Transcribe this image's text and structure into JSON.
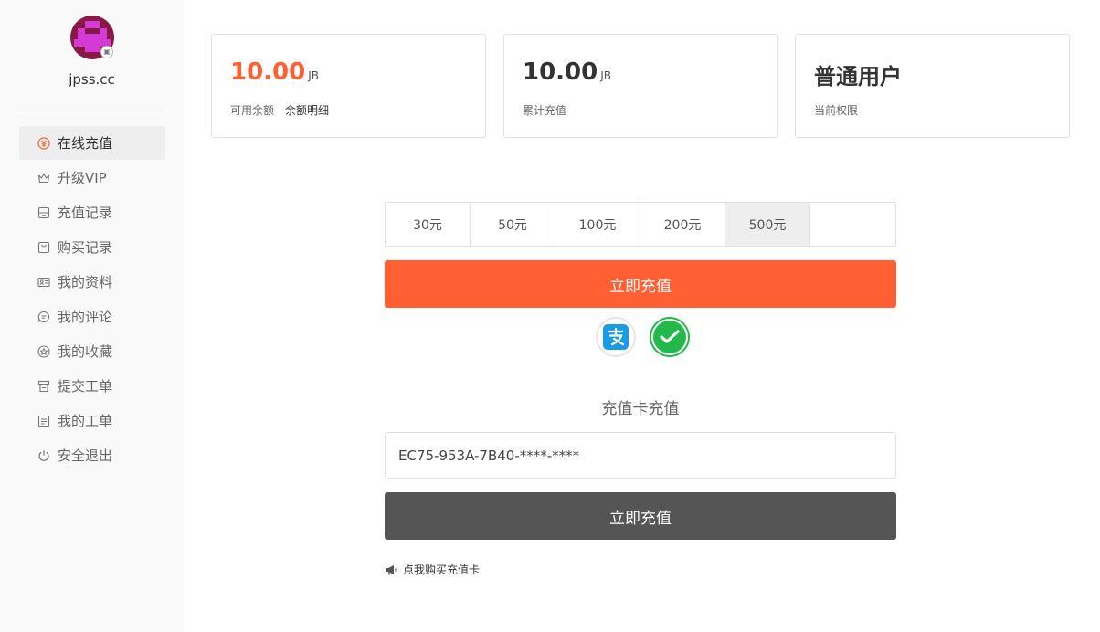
{
  "sidebar": {
    "site_name": "jpss.cc",
    "menu": [
      {
        "label": "在线充值",
        "icon": "yuan-icon",
        "active": true
      },
      {
        "label": "升级VIP",
        "icon": "crown-icon"
      },
      {
        "label": "充值记录",
        "icon": "record-icon"
      },
      {
        "label": "购买记录",
        "icon": "bag-icon"
      },
      {
        "label": "我的资料",
        "icon": "profile-card-icon"
      },
      {
        "label": "我的评论",
        "icon": "comment-icon"
      },
      {
        "label": "我的收藏",
        "icon": "star-icon"
      },
      {
        "label": "提交工单",
        "icon": "ticket-icon"
      },
      {
        "label": "我的工单",
        "icon": "document-icon"
      },
      {
        "label": "安全退出",
        "icon": "power-icon"
      }
    ]
  },
  "stats": {
    "balance": {
      "value": "10.00",
      "unit": "JB",
      "label": "可用余额",
      "link": "余额明细"
    },
    "total_recharge": {
      "value": "10.00",
      "unit": "JB",
      "label": "累计充值"
    },
    "permission": {
      "value": "普通用户",
      "label": "当前权限"
    }
  },
  "recharge": {
    "amounts": [
      "30元",
      "50元",
      "100元",
      "200元",
      "500元"
    ],
    "selected_amount": "500元",
    "submit_label": "立即充值",
    "payment_methods": [
      "alipay-icon",
      "wechat-pay-icon"
    ]
  },
  "card_recharge": {
    "title": "充值卡充值",
    "input_value": "EC75-953A-7B40-****-****",
    "submit_label": "立即充值",
    "buy_link": "点我购买充值卡"
  },
  "colors": {
    "accent": "#ff5f33",
    "dark_button": "#555555",
    "wechat": "#22b84a",
    "alipay": "#1a9be6"
  }
}
